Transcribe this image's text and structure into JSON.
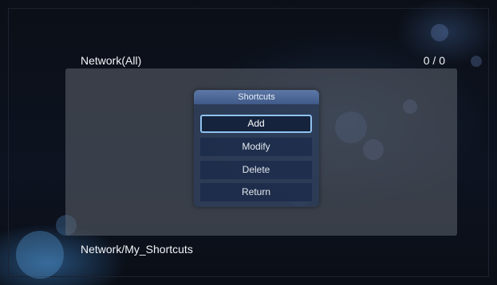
{
  "header": {
    "title": "Network(All)",
    "count": "0 / 0"
  },
  "dialog": {
    "title": "Shortcuts",
    "items": [
      {
        "label": "Add",
        "selected": true
      },
      {
        "label": "Modify",
        "selected": false
      },
      {
        "label": "Delete",
        "selected": false
      },
      {
        "label": "Return",
        "selected": false
      }
    ]
  },
  "footer": {
    "path": "Network/My_Shortcuts"
  },
  "colors": {
    "background": "#0b0f17",
    "panel": "#5f646e",
    "dialog": "#283a5a",
    "dialog_title": "#4f6a98",
    "selection_border": "#8fc2ee",
    "text": "#f2f4f8"
  }
}
